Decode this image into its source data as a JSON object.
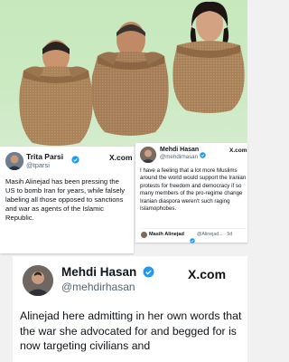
{
  "tweets": [
    {
      "name": "Trita Parsi",
      "handle": "@tparsi",
      "logo": "X.com",
      "text": "Masih Alinejad has been pressing the US to bomb Iran for years, while falsely labeling all those opposed to sanctions and war as agents of the Islamic Republic."
    },
    {
      "name": "Mehdi Hasan",
      "handle": "@mehdirhasan",
      "logo": "X.com",
      "text": "I have a feeling that a lot more Muslims around the world would support the Iranian protests for freedom and democracy if so many members of the pro-regime change Iranian diaspora weren't such raging Islamophobes.",
      "quoted": {
        "name": "Masih Alinejad",
        "meta": "@Alinejad... · 5d"
      }
    },
    {
      "name": "Mehdi Hasan",
      "handle": "@mehdirhasan",
      "logo": "X.com",
      "text": "Alinejad here admitting in her own words that the war she advocated for and begged for is now targeting civilians and"
    }
  ],
  "colors": {
    "verified": "#1d9bf0",
    "meme_background": "#c9e9c0",
    "sack": "#a9825a"
  },
  "icons": [
    "verified-badge-icon",
    "x-logo-icon",
    "avatar"
  ]
}
